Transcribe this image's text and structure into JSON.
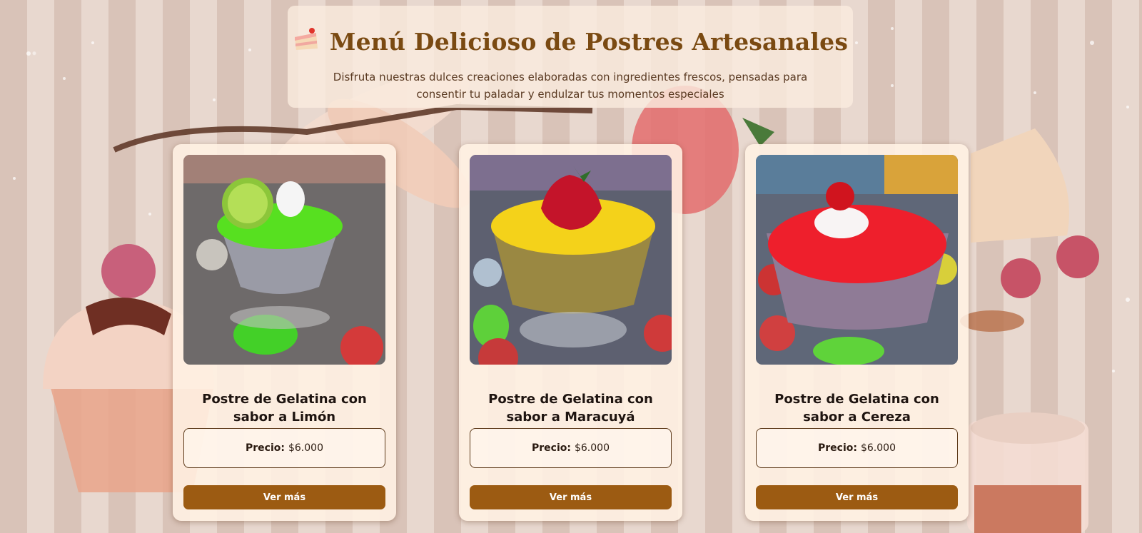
{
  "header": {
    "icon": "cake-icon",
    "title": "Menú Delicioso de Postres Artesanales",
    "subtitle": "Disfruta nuestras dulces creaciones elaboradas con ingredientes frescos, pensadas para consentir tu paladar y endulzar tus momentos especiales"
  },
  "products": [
    {
      "name": "Postre de Gelatina con sabor a Limón",
      "price_label": "Precio:",
      "price": "$6.000",
      "button": "Ver más",
      "jelly_color": "#57e020",
      "base_color": "#9a9ba6",
      "garnish": "lime-slice"
    },
    {
      "name": "Postre de Gelatina con sabor a Maracuyá",
      "price_label": "Precio:",
      "price": "$6.000",
      "button": "Ver más",
      "jelly_color": "#f4d21a",
      "base_color": "#9a8842",
      "garnish": "strawberry"
    },
    {
      "name": "Postre de Gelatina con sabor a Cereza",
      "price_label": "Precio:",
      "price": "$6.000",
      "button": "Ver más",
      "jelly_color": "#ee1f2c",
      "base_color": "#8f7b96",
      "garnish": "cherry-cream"
    }
  ],
  "colors": {
    "accent": "#9c5b12",
    "title": "#7a4a12"
  }
}
